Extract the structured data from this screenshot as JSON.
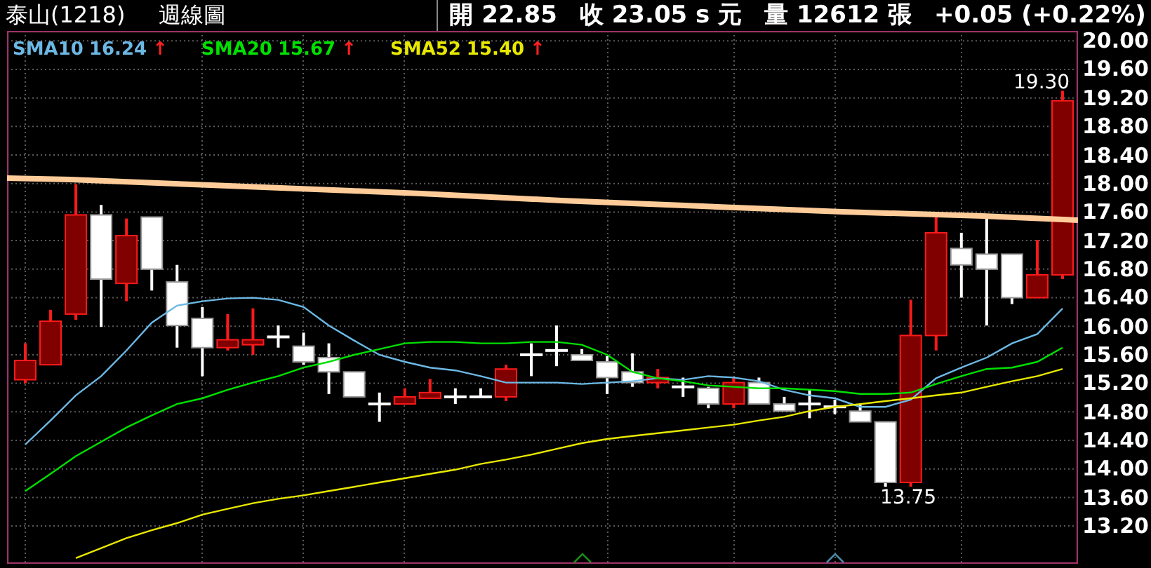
{
  "header": {
    "stock": "泰山(1218)",
    "period": "週線圖",
    "quote": [
      {
        "text": "開 22.85"
      },
      {
        "text": "收 23.05 s 元"
      },
      {
        "text": "量 12612 張"
      },
      {
        "text": "+0.05 (+0.22%)"
      }
    ]
  },
  "legend": [
    {
      "value": "16.24",
      "arrow": "↑"
    },
    {
      "value": "15.67",
      "arrow": "↑"
    },
    {
      "value": "15.40",
      "arrow": "↑"
    }
  ],
  "chart": {
    "chart_data": {
      "type": "candlestick",
      "grid": true,
      "ohlc": [
        [
          15.25,
          15.76,
          15.2,
          15.52
        ],
        [
          15.46,
          16.23,
          15.46,
          16.07
        ],
        [
          16.17,
          17.99,
          16.09,
          17.56
        ],
        [
          17.56,
          17.7,
          15.99,
          16.66
        ],
        [
          16.6,
          17.51,
          16.35,
          17.27
        ],
        [
          17.53,
          17.53,
          16.5,
          16.8
        ],
        [
          16.62,
          16.86,
          15.7,
          16.01
        ],
        [
          16.11,
          16.27,
          15.3,
          15.7
        ],
        [
          15.7,
          16.17,
          15.66,
          15.81
        ],
        [
          15.74,
          16.25,
          15.6,
          15.81
        ],
        [
          15.85,
          16.01,
          15.7,
          15.85
        ],
        [
          15.72,
          15.91,
          15.46,
          15.5
        ],
        [
          15.56,
          15.76,
          15.05,
          15.36
        ],
        [
          15.36,
          15.36,
          15.01,
          15.01
        ],
        [
          14.91,
          15.07,
          14.66,
          14.91
        ],
        [
          14.91,
          15.13,
          14.91,
          15.01
        ],
        [
          14.99,
          15.26,
          14.99,
          15.07
        ],
        [
          15.01,
          15.13,
          14.91,
          15.01
        ],
        [
          15.01,
          15.13,
          15.01,
          15.01
        ],
        [
          15.01,
          15.46,
          14.95,
          15.4
        ],
        [
          15.6,
          15.76,
          15.3,
          15.6
        ],
        [
          15.66,
          16.01,
          15.44,
          15.66
        ],
        [
          15.6,
          15.68,
          15.52,
          15.52
        ],
        [
          15.5,
          15.58,
          15.05,
          15.28
        ],
        [
          15.36,
          15.62,
          15.15,
          15.21
        ],
        [
          15.21,
          15.4,
          15.13,
          15.28
        ],
        [
          15.15,
          15.28,
          15.01,
          15.15
        ],
        [
          15.13,
          15.15,
          14.85,
          14.91
        ],
        [
          14.91,
          15.28,
          14.85,
          15.21
        ],
        [
          15.21,
          15.28,
          14.91,
          14.91
        ],
        [
          14.91,
          15.01,
          14.81,
          14.81
        ],
        [
          14.91,
          15.11,
          14.71,
          14.91
        ],
        [
          14.87,
          14.97,
          14.77,
          14.87
        ],
        [
          14.81,
          14.91,
          14.66,
          14.66
        ],
        [
          14.66,
          14.66,
          13.75,
          13.81
        ],
        [
          13.81,
          16.37,
          13.75,
          15.87
        ],
        [
          15.87,
          17.53,
          15.66,
          17.31
        ],
        [
          17.09,
          17.31,
          16.4,
          16.86
        ],
        [
          17.01,
          17.53,
          16.01,
          16.8
        ],
        [
          17.01,
          17.01,
          16.31,
          16.4
        ],
        [
          16.4,
          17.21,
          16.4,
          16.72
        ],
        [
          16.72,
          19.3,
          16.66,
          19.16
        ]
      ],
      "categories": [
        null,
        null,
        null,
        null,
        null,
        null,
        null,
        null,
        null,
        null,
        null,
        null,
        null,
        null,
        null,
        null,
        null,
        null,
        null,
        null,
        null,
        null,
        null,
        null,
        null,
        null,
        null,
        null,
        null,
        null,
        null,
        null,
        null,
        null,
        null,
        null,
        null,
        null,
        null,
        null,
        null,
        null
      ],
      "ylim": [
        12.67,
        20.14
      ],
      "series": [
        {
          "name": "SMA10",
          "type": "line",
          "color": "#6cb8e4",
          "values": [
            14.34,
            14.68,
            15.03,
            15.3,
            15.66,
            16.05,
            16.29,
            16.35,
            16.39,
            16.4,
            16.37,
            16.27,
            16.01,
            15.8,
            15.6,
            15.5,
            15.42,
            15.38,
            15.3,
            15.21,
            15.21,
            15.21,
            15.19,
            15.21,
            15.23,
            15.27,
            15.25,
            15.3,
            15.28,
            15.23,
            15.11,
            15.03,
            14.99,
            14.87,
            14.87,
            14.97,
            15.27,
            15.42,
            15.56,
            15.76,
            15.89,
            16.25
          ]
        },
        {
          "name": "SMA20",
          "type": "line",
          "color": "#00e000",
          "values": [
            13.69,
            13.93,
            14.18,
            14.38,
            14.58,
            14.75,
            14.91,
            14.99,
            15.11,
            15.21,
            15.3,
            15.42,
            15.5,
            15.6,
            15.68,
            15.76,
            15.78,
            15.78,
            15.76,
            15.76,
            15.78,
            15.78,
            15.74,
            15.6,
            15.36,
            15.27,
            15.23,
            15.17,
            15.15,
            15.13,
            15.13,
            15.11,
            15.09,
            15.05,
            15.05,
            15.07,
            15.19,
            15.3,
            15.4,
            15.42,
            15.5,
            15.7
          ]
        },
        {
          "name": "SMA52",
          "type": "line",
          "color": "#e8e800",
          "values": [
            null,
            null,
            12.75,
            12.89,
            13.03,
            13.14,
            13.24,
            13.36,
            13.44,
            13.52,
            13.58,
            13.63,
            13.69,
            13.75,
            13.81,
            13.87,
            13.93,
            13.99,
            14.07,
            14.13,
            14.2,
            14.28,
            14.36,
            14.42,
            14.46,
            14.5,
            14.54,
            14.58,
            14.62,
            14.68,
            14.73,
            14.81,
            14.87,
            14.91,
            14.95,
            14.99,
            15.03,
            15.07,
            15.15,
            15.23,
            15.3,
            15.4
          ]
        }
      ],
      "yticks": [
        {
          "value": 20.0,
          "label": "20.00"
        },
        {
          "value": 19.6,
          "label": "19.60"
        },
        {
          "value": 19.2,
          "label": "19.20"
        },
        {
          "value": 18.8,
          "label": "18.80"
        },
        {
          "value": 18.4,
          "label": "18.40"
        },
        {
          "value": 18.0,
          "label": "18.00"
        },
        {
          "value": 17.6,
          "label": "17.60"
        },
        {
          "value": 17.2,
          "label": "17.20"
        },
        {
          "value": 16.8,
          "label": "16.80"
        },
        {
          "value": 16.4,
          "label": "16.40"
        },
        {
          "value": 16.0,
          "label": "16.00"
        },
        {
          "value": 15.6,
          "label": "15.60"
        },
        {
          "value": 15.2,
          "label": "15.20"
        },
        {
          "value": 14.8,
          "label": "14.80"
        },
        {
          "value": 14.4,
          "label": "14.40"
        },
        {
          "value": 14.0,
          "label": "14.00"
        },
        {
          "value": 13.6,
          "label": "13.60"
        },
        {
          "value": 13.2,
          "label": "13.20"
        }
      ],
      "annotations": [
        "19.30",
        "13.75"
      ]
    }
  }
}
